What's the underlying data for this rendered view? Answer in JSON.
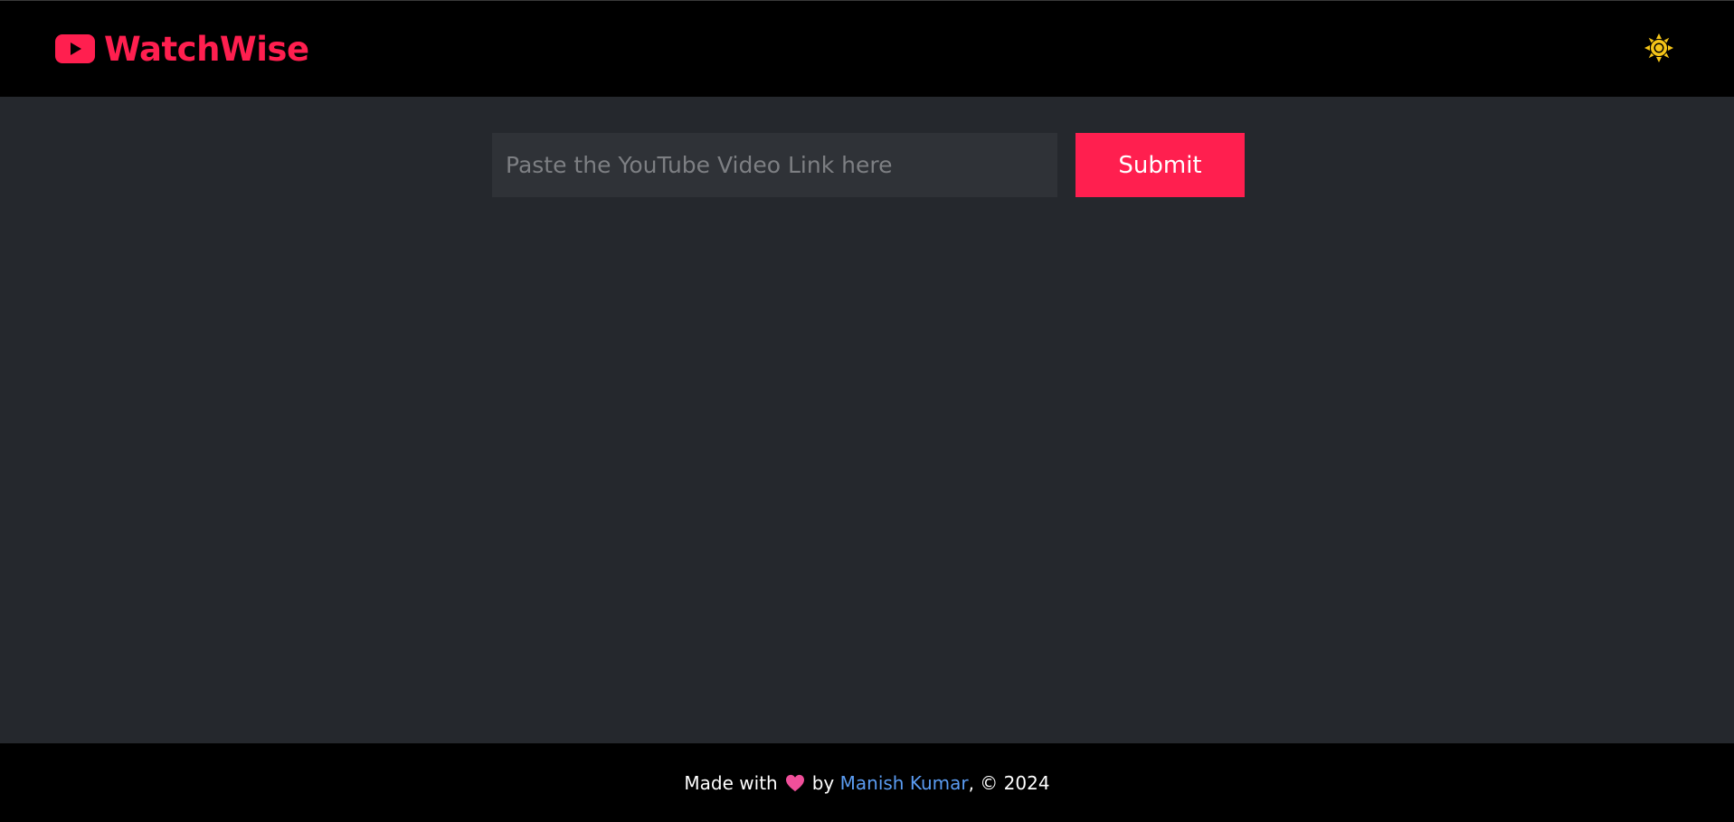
{
  "header": {
    "brand_name": "WatchWise",
    "brand_color": "#ff1f4f",
    "brand_icon": "youtube-play-icon",
    "theme_toggle_icon": "sun-icon",
    "theme_toggle_color": "#f5c518"
  },
  "search": {
    "input_value": "",
    "placeholder": "Paste the YouTube Video Link here",
    "submit_label": "Submit"
  },
  "footer": {
    "made_with": "Made with",
    "heart_icon": "heart-icon",
    "by": "by",
    "author": "Manish Kumar",
    "copyright": ", © 2024",
    "link_color": "#5b9cf2"
  },
  "colors": {
    "header_bg": "#000000",
    "main_bg": "#25282d",
    "input_bg": "#2f3237",
    "accent": "#ff1f4f"
  }
}
